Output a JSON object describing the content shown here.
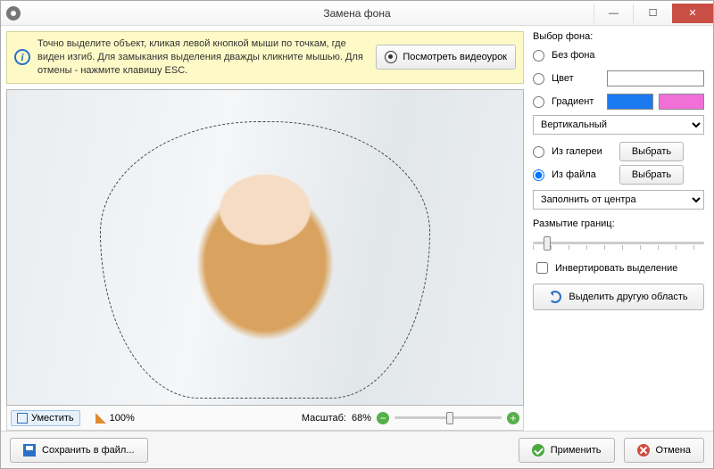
{
  "window": {
    "title": "Замена фона"
  },
  "hint": {
    "text": "Точно выделите объект, кликая левой кнопкой мыши по точкам, где виден изгиб. Для замыкания выделения дважды кликните мышью. Для отмены - нажмите клавишу ESC.",
    "video_button": "Посмотреть видеоурок"
  },
  "canvas_toolbar": {
    "fit_label": "Уместить",
    "zoom_label_a": "100%",
    "scale_label": "Масштаб:",
    "scale_value": "68%",
    "slider_pos_pct": 48
  },
  "right_panel": {
    "header": "Выбор фона:",
    "opt_no_bg": "Без фона",
    "opt_color": "Цвет",
    "opt_gradient": "Градиент",
    "gradient_dir_options": [
      "Вертикальный"
    ],
    "gradient_dir_selected": "Вертикальный",
    "opt_gallery": "Из галереи",
    "opt_file": "Из файла",
    "choose_btn": "Выбрать",
    "fill_options": [
      "Заполнить от центра"
    ],
    "fill_selected": "Заполнить от центра",
    "blur_label": "Размытие границ:",
    "blur_pos_pct": 6,
    "invert_label": "Инвертировать выделение",
    "select_other_btn": "Выделить другую область",
    "selected_option": "file"
  },
  "footer": {
    "save_btn": "Сохранить в файл...",
    "apply_btn": "Применить",
    "cancel_btn": "Отмена"
  },
  "colors": {
    "gradient_a": "#1a7af0",
    "gradient_b": "#f070d8"
  }
}
